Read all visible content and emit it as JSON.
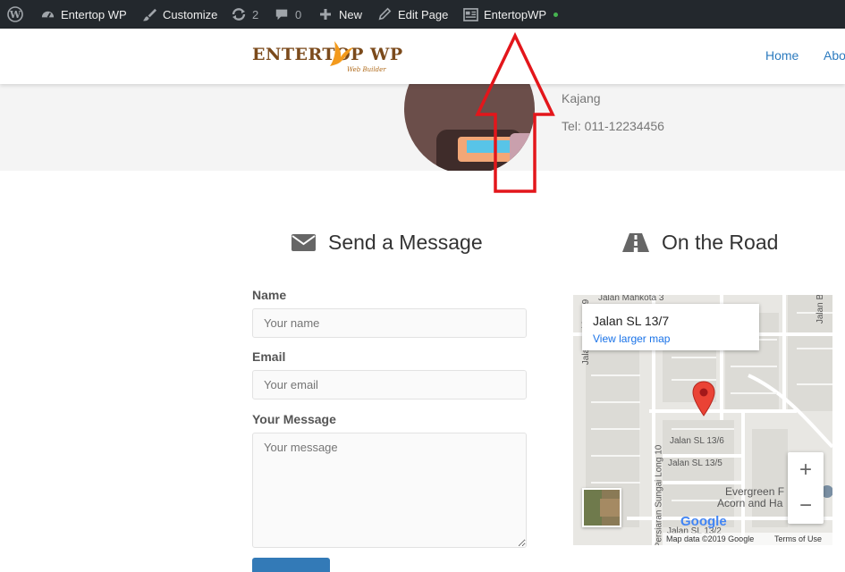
{
  "admin_bar": {
    "site_name": "Entertop WP",
    "customize": "Customize",
    "updates_count": "2",
    "comments_count": "0",
    "new": "New",
    "edit_page": "Edit Page",
    "theme": "EntertopWP"
  },
  "header": {
    "logo_text": "ENTERTOP WP",
    "logo_sub": "Web Builder",
    "nav": [
      "Home",
      "Abo"
    ]
  },
  "hero": {
    "city": "Kajang",
    "phone": "Tel: 011-12234456"
  },
  "contact_form": {
    "title": "Send a Message",
    "name_label": "Name",
    "name_placeholder": "Your name",
    "email_label": "Email",
    "email_placeholder": "Your email",
    "message_label": "Your Message",
    "message_placeholder": "Your message"
  },
  "map": {
    "title": "On the Road",
    "card_title": "Jalan SL 13/7",
    "card_link": "View larger map",
    "roads": [
      "Jalan Mahkota 3",
      "Jalan Mahkota 9",
      "Jalan SL 13/6",
      "Jalan SL 13/5",
      "Persiaran Sungai Long 10",
      "Evergreen F",
      "Acorn and Ha",
      "Jalan SL 13/2",
      "Jalan B"
    ],
    "footer_data": "Map data ©2019 Google",
    "footer_terms": "Terms of Use",
    "google": "Google",
    "zoom_in": "+",
    "zoom_out": "−"
  },
  "colors": {
    "admin_bg": "#23282d",
    "link": "#2c7bbf",
    "annotation": "#e3161b",
    "pin": "#ea4335"
  }
}
